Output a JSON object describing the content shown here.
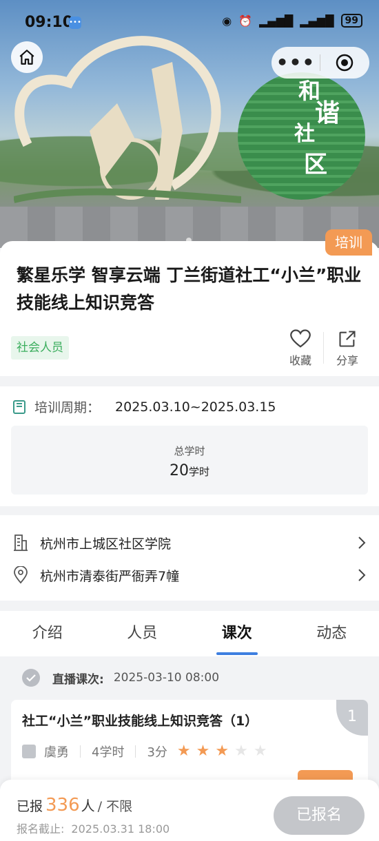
{
  "status_bar": {
    "time": "09:10",
    "battery": "99"
  },
  "hero": {
    "sign_chars": [
      "和",
      "谐",
      "社",
      "区"
    ]
  },
  "activity": {
    "category_tag": "培训",
    "title": "繁星乐学 智享云端 丁兰街道社工“小兰”职业技能线上知识竞答",
    "audience_tag": "社会人员",
    "actions": {
      "favorite": "收藏",
      "share": "分享"
    }
  },
  "period": {
    "label": "培训周期：",
    "value": "2025.03.10~2025.03.15",
    "total_hours_label": "总学时",
    "total_hours_value": "20",
    "total_hours_unit": "学时"
  },
  "location": {
    "institution": "杭州市上城区社区学院",
    "address": "杭州市清泰街严衙弄7幢"
  },
  "tabs": [
    {
      "label": "介绍",
      "active": false
    },
    {
      "label": "人员",
      "active": false
    },
    {
      "label": "课次",
      "active": true
    },
    {
      "label": "动态",
      "active": false
    }
  ],
  "live_session": {
    "label": "直播课次:",
    "datetime": "2025-03-10 08:00"
  },
  "lesson": {
    "title": "社工“小兰”职业技能线上知识竞答（1）",
    "number": "1",
    "teacher": "虞勇",
    "hours": "4学时",
    "score": "3分",
    "rating": 3,
    "rating_max": 5
  },
  "bottom_bar": {
    "registered_prefix": "已报",
    "registered_count": "336",
    "registered_unit": "人",
    "limit_text": "/ 不限",
    "deadline_label": "报名截止:",
    "deadline_value": "2025.03.31 18:00",
    "register_button": "已报名"
  },
  "colors": {
    "accent_orange": "#f39a54",
    "tab_underline": "#3e7fe0",
    "audience_green": "#3cae5e",
    "disabled_button": "#c4c6ca"
  },
  "icons": [
    "home-icon",
    "more-icon",
    "close-mini-program-icon",
    "heart-icon",
    "share-icon",
    "book-icon",
    "building-icon",
    "location-pin-icon",
    "chevron-right-icon",
    "check-circle-icon",
    "teacher-icon",
    "star-icon"
  ]
}
